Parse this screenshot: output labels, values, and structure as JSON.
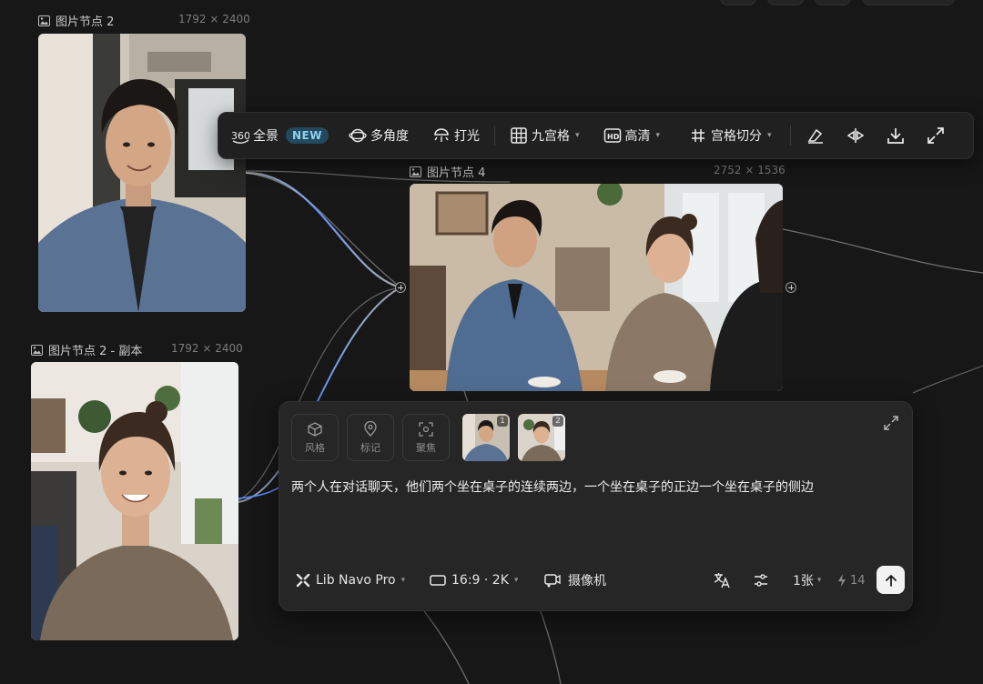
{
  "nodes": {
    "node_a": {
      "title": "图片节点 2",
      "dims": "1792 × 2400"
    },
    "node_b": {
      "title": "图片节点 2 - 副本",
      "dims": "1792 × 2400"
    },
    "node_c": {
      "title": "图片节点 4",
      "dims": "2752 × 1536"
    }
  },
  "toolbar": {
    "panorama_label": "全景",
    "panorama_badge": "NEW",
    "multi_angle_label": "多角度",
    "lighting_label": "打光",
    "grid9_label": "九宫格",
    "hd_label": "高清",
    "grid_split_label": "宫格切分",
    "icons": [
      "eraser-icon",
      "flip-icon",
      "download-icon",
      "expand-icon"
    ]
  },
  "prompt_panel": {
    "tools": [
      {
        "label": "风格",
        "icon": "cube-icon"
      },
      {
        "label": "标记",
        "icon": "pin-icon"
      },
      {
        "label": "聚焦",
        "icon": "focus-icon"
      }
    ],
    "references": [
      {
        "number": "1",
        "subject": "man-in-denim-jacket"
      },
      {
        "number": "2",
        "subject": "woman-in-sweater"
      }
    ],
    "prompt_text": "两个人在对话聊天，他们两个坐在桌子的连续两边，一个坐在桌子的正边一个坐在桌子的侧边",
    "model_label": "Lib Navo Pro",
    "ratio_label": "16:9 · 2K",
    "camera_label": "摄像机",
    "count_label": "1张",
    "credits": "14"
  },
  "colors": {
    "background": "#171717",
    "panel": "#262626",
    "accent_badge": "#8fd2f2",
    "wire_highlight": "#5b8cff"
  }
}
